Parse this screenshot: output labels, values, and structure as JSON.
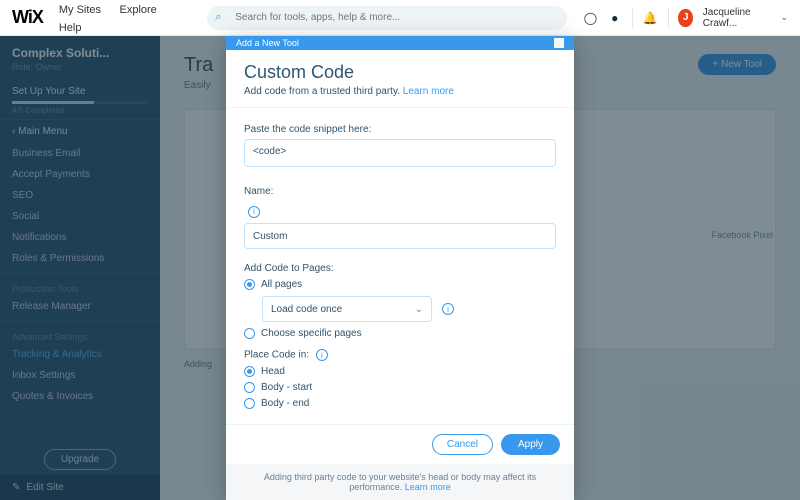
{
  "topbar": {
    "logo": "WiX",
    "nav": {
      "mysites": "My Sites",
      "explore": "Explore",
      "help": "Help"
    },
    "search_placeholder": "Search for tools, apps, help & more...",
    "user_initial": "J",
    "user_name": "Jacqueline Crawf..."
  },
  "sidebar": {
    "site_name": "Complex Soluti...",
    "role": "Role: Owner",
    "setup_label": "Set Up Your Site",
    "progress_text": "4/5 Completed",
    "back_label": "Main Menu",
    "group1": {
      "business_email": "Business Email",
      "accept_payments": "Accept Payments",
      "seo": "SEO",
      "social": "Social",
      "notifications": "Notifications",
      "roles": "Roles & Permissions"
    },
    "group2_header": "Production Tools",
    "group2": {
      "release_manager": "Release Manager"
    },
    "group3_header": "Advanced Settings",
    "group3": {
      "tracking": "Tracking & Analytics",
      "inbox": "Inbox Settings",
      "quotes": "Quotes & Invoices"
    },
    "upgrade": "Upgrade",
    "edit_site": "Edit Site"
  },
  "main": {
    "title": "Tra",
    "subtitle": "Easily",
    "new_tool": "+   New Tool",
    "card_tag": "Facebook Pixel",
    "adding_text": "Adding"
  },
  "modal": {
    "bar_title": "Add a New Tool",
    "title": "Custom Code",
    "desc_pre": "Add code from a trusted third party. ",
    "learn_more": "Learn more",
    "paste_label": "Paste the code snippet here:",
    "paste_value": "<code>",
    "name_label": "Name:",
    "name_value": "Custom",
    "pages_label": "Add Code to Pages:",
    "pages_all": "All pages",
    "pages_choose": "Choose specific pages",
    "load_option": "Load code once",
    "place_label": "Place Code in:",
    "place_head": "Head",
    "place_body_start": "Body - start",
    "place_body_end": "Body - end",
    "cancel": "Cancel",
    "apply": "Apply",
    "note_pre": "Adding third party code to your website's head or body may affect its performance. ",
    "note_link": "Learn more"
  }
}
